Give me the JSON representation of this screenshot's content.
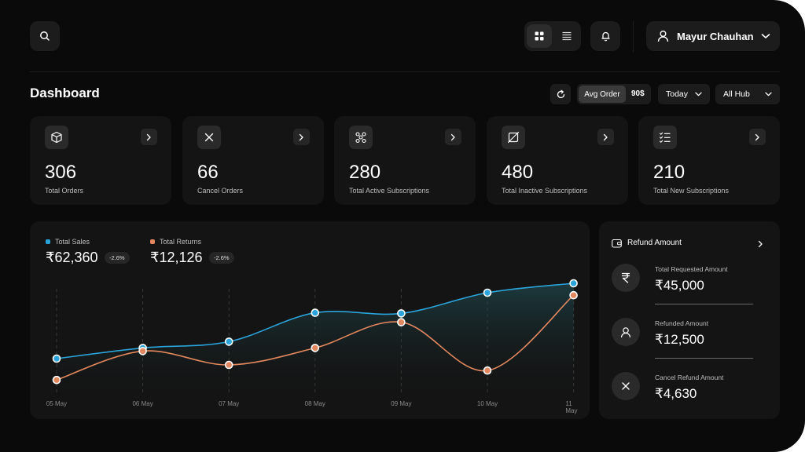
{
  "header": {
    "user_name": "Mayur Chauhan",
    "icons": [
      "search-icon",
      "grid-view-icon",
      "list-view-icon",
      "bell-icon",
      "user-icon",
      "chevron-down-icon"
    ]
  },
  "toolbar": {
    "page_title": "Dashboard",
    "avg_order_label": "Avg Order",
    "avg_order_value": "90$",
    "date_filter": "Today",
    "hub_filter": "All Hub"
  },
  "stats": [
    {
      "value": "306",
      "label": "Total Orders",
      "icon": "box-icon"
    },
    {
      "value": "66",
      "label": "Cancel Orders",
      "icon": "close-icon"
    },
    {
      "value": "280",
      "label": "Total Active Subscriptions",
      "icon": "nodes-icon"
    },
    {
      "value": "480",
      "label": "Total Inactive Subscriptions",
      "icon": "crossed-square-icon"
    },
    {
      "value": "210",
      "label": "Total New Subscriptions",
      "icon": "checklist-icon"
    }
  ],
  "sales": {
    "sales_label": "Total Sales",
    "sales_value": "₹62,360",
    "sales_change": "-2.6%",
    "returns_label": "Total Returns",
    "returns_value": "₹12,126",
    "returns_change": "-2.6%"
  },
  "colors": {
    "sales": "#2ba4db",
    "returns": "#e3875f",
    "background": "#0a0a0a",
    "card": "#141414"
  },
  "chart_data": {
    "type": "line",
    "x": [
      "05 May",
      "06 May",
      "07 May",
      "08 May",
      "09 May",
      "10 May",
      "11 May"
    ],
    "series": [
      {
        "name": "Total Sales",
        "values": [
          5,
          22,
          32,
          78,
          77,
          110,
          125
        ]
      },
      {
        "name": "Total Returns",
        "values": [
          -29,
          17,
          -5,
          22,
          63,
          -14,
          106
        ]
      }
    ],
    "grid": false
  },
  "refund": {
    "title": "Refund Amount",
    "items": [
      {
        "label": "Total Requested Amount",
        "value": "₹45,000",
        "icon": "rupee-icon"
      },
      {
        "label": "Refunded Amount",
        "value": "₹12,500",
        "icon": "user-icon"
      },
      {
        "label": "Cancel Refund Amount",
        "value": "₹4,630",
        "icon": "close-icon"
      }
    ]
  }
}
